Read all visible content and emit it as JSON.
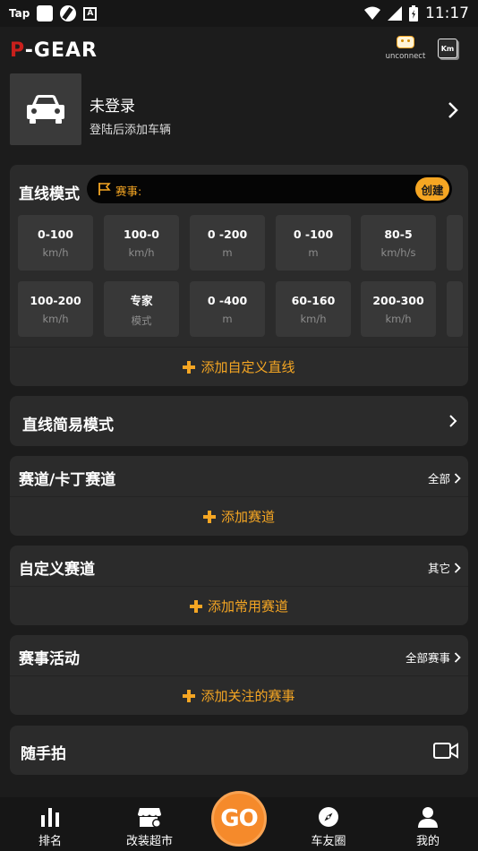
{
  "status_bar": {
    "left_label": "Tap",
    "time": "11:17"
  },
  "header": {
    "logo_prefix": "P",
    "logo_rest": "-GEAR",
    "connect_label": "unconnect",
    "km_label": "Km"
  },
  "user": {
    "title": "未登录",
    "subtitle": "登陆后添加车辆"
  },
  "straight_mode": {
    "title": "直线模式",
    "event_label": "赛事:",
    "create_button": "创建",
    "modes_row1": [
      {
        "value": "0-100",
        "unit": "km/h"
      },
      {
        "value": "100-0",
        "unit": "km/h"
      },
      {
        "value": "0 -200",
        "unit": "m"
      },
      {
        "value": "0 -100",
        "unit": "m"
      },
      {
        "value": "80-5",
        "unit": "km/h/s"
      }
    ],
    "modes_row2": [
      {
        "value": "100-200",
        "unit": "km/h"
      },
      {
        "value": "专家",
        "unit": "模式"
      },
      {
        "value": "0 -400",
        "unit": "m"
      },
      {
        "value": "60-160",
        "unit": "km/h"
      },
      {
        "value": "200-300",
        "unit": "km/h"
      }
    ],
    "add_label": "添加自定义直线"
  },
  "simple_mode": {
    "title": "直线简易模式"
  },
  "track": {
    "title": "赛道/卡丁赛道",
    "link": "全部",
    "add_label": "添加赛道"
  },
  "custom_track": {
    "title": "自定义赛道",
    "link": "其它",
    "add_label": "添加常用赛道"
  },
  "events": {
    "title": "赛事活动",
    "link": "全部赛事",
    "add_label": "添加关注的赛事"
  },
  "snapshot": {
    "title": "随手拍",
    "icon": "video-camera-icon"
  },
  "nav": {
    "rank": "排名",
    "mod_store": "改装超市",
    "go": "GO",
    "friends": "车友圈",
    "mine": "我的"
  },
  "colors": {
    "accent": "#f5a623",
    "go_button": "#f58a2b",
    "brand_red": "#c8201c",
    "card_bg": "#2b2b2b",
    "page_bg": "#1c1c1c"
  }
}
